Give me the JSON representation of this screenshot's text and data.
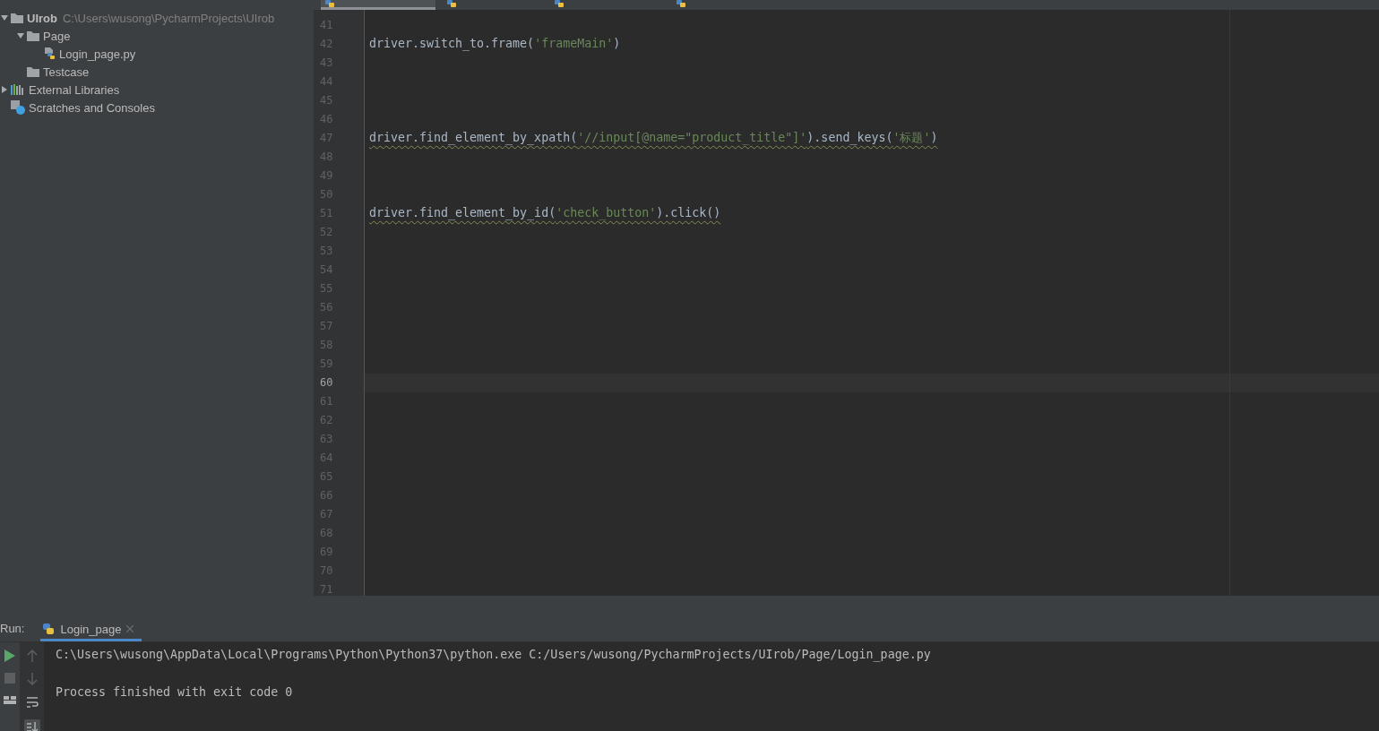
{
  "sidebar": {
    "tree": [
      {
        "label": "UIrob",
        "path": "C:\\Users\\wusong\\PycharmProjects\\UIrob",
        "kind": "folder",
        "expanded": true,
        "children": [
          {
            "label": "Page",
            "kind": "folder",
            "expanded": true,
            "children": [
              {
                "label": "Login_page.py",
                "kind": "python"
              }
            ]
          },
          {
            "label": "Testcase",
            "kind": "folder"
          }
        ]
      },
      {
        "label": "External Libraries",
        "kind": "library",
        "expanded": false
      },
      {
        "label": "Scratches and Consoles",
        "kind": "scratch"
      }
    ]
  },
  "editor_tabs": [
    {
      "selected": true
    },
    {
      "selected": false
    },
    {
      "selected": false
    },
    {
      "selected": false
    }
  ],
  "editor": {
    "lines": [
      {
        "number": "41",
        "current": false
      },
      {
        "number": "42",
        "current": false,
        "warning": false,
        "code": [
          {
            "kind": "code",
            "text": "driver.switch_to.frame("
          },
          {
            "kind": "string",
            "text": "'frameMain'"
          },
          {
            "kind": "code",
            "text": ")"
          }
        ]
      },
      {
        "number": "43",
        "current": false
      },
      {
        "number": "44",
        "current": false
      },
      {
        "number": "45",
        "current": false
      },
      {
        "number": "46",
        "current": false
      },
      {
        "number": "47",
        "current": false,
        "warning": true,
        "code": [
          {
            "kind": "code",
            "text": "driver.find_element_by_xpath("
          },
          {
            "kind": "string",
            "text": "'//input[@name=\"product_title\"]'"
          },
          {
            "kind": "code",
            "text": ").send_keys("
          },
          {
            "kind": "string",
            "text": "'标题'"
          },
          {
            "kind": "code",
            "text": ")"
          }
        ]
      },
      {
        "number": "48",
        "current": false
      },
      {
        "number": "49",
        "current": false
      },
      {
        "number": "50",
        "current": false
      },
      {
        "number": "51",
        "current": false,
        "warning": true,
        "code": [
          {
            "kind": "code",
            "text": "driver.find_element_by_id("
          },
          {
            "kind": "string",
            "text": "'check_button'"
          },
          {
            "kind": "code",
            "text": ").click()"
          }
        ]
      },
      {
        "number": "52",
        "current": false
      },
      {
        "number": "53",
        "current": false
      },
      {
        "number": "54",
        "current": false
      },
      {
        "number": "55",
        "current": false
      },
      {
        "number": "56",
        "current": false
      },
      {
        "number": "57",
        "current": false
      },
      {
        "number": "58",
        "current": false
      },
      {
        "number": "59",
        "current": false
      },
      {
        "number": "60",
        "current": true
      },
      {
        "number": "61",
        "current": false
      },
      {
        "number": "62",
        "current": false
      },
      {
        "number": "63",
        "current": false
      },
      {
        "number": "64",
        "current": false
      },
      {
        "number": "65",
        "current": false
      },
      {
        "number": "66",
        "current": false
      },
      {
        "number": "67",
        "current": false
      },
      {
        "number": "68",
        "current": false
      },
      {
        "number": "69",
        "current": false
      },
      {
        "number": "70",
        "current": false
      },
      {
        "number": "71",
        "current": false
      }
    ]
  },
  "run": {
    "label": "Run:",
    "tabs": [
      {
        "label": "Login_page",
        "selected": true
      }
    ],
    "output": [
      "C:\\Users\\wusong\\AppData\\Local\\Programs\\Python\\Python37\\python.exe C:/Users/wusong/PycharmProjects/UIrob/Page/Login_page.py",
      "Process finished with exit code 0"
    ]
  }
}
